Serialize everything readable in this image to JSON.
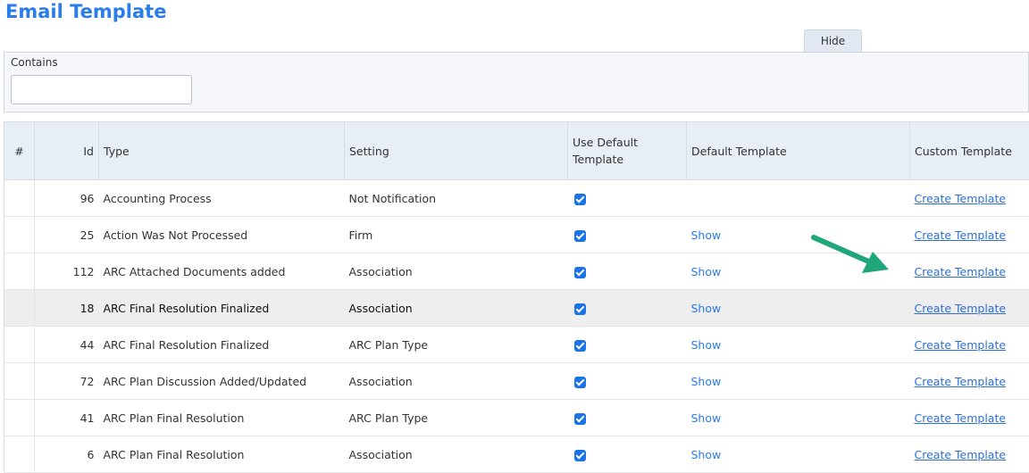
{
  "page": {
    "title": "Email Template"
  },
  "filter": {
    "hide_label": "Hide",
    "contains_label": "Contains",
    "contains_value": ""
  },
  "table": {
    "columns": {
      "num": "#",
      "id": "Id",
      "type": "Type",
      "setting": "Setting",
      "use_default": "Use Default Template",
      "default_template": "Default Template",
      "custom_template": "Custom Template"
    },
    "rows": [
      {
        "id": "96",
        "type": "Accounting Process",
        "setting": "Not Notification",
        "use_default": true,
        "default_template": "",
        "custom_template": "Create Template",
        "selected": false
      },
      {
        "id": "25",
        "type": "Action Was Not Processed",
        "setting": "Firm",
        "use_default": true,
        "default_template": "Show",
        "custom_template": "Create Template",
        "selected": false
      },
      {
        "id": "112",
        "type": "ARC Attached Documents added",
        "setting": "Association",
        "use_default": true,
        "default_template": "Show",
        "custom_template": "Create Template",
        "selected": false
      },
      {
        "id": "18",
        "type": "ARC Final Resolution Finalized",
        "setting": "Association",
        "use_default": true,
        "default_template": "Show",
        "custom_template": "Create Template",
        "selected": true
      },
      {
        "id": "44",
        "type": "ARC Final Resolution Finalized",
        "setting": "ARC Plan Type",
        "use_default": true,
        "default_template": "Show",
        "custom_template": "Create Template",
        "selected": false
      },
      {
        "id": "72",
        "type": "ARC Plan Discussion Added/Updated",
        "setting": "Association",
        "use_default": true,
        "default_template": "Show",
        "custom_template": "Create Template",
        "selected": false
      },
      {
        "id": "41",
        "type": "ARC Plan Final Resolution",
        "setting": "ARC Plan Type",
        "use_default": true,
        "default_template": "Show",
        "custom_template": "Create Template",
        "selected": false
      },
      {
        "id": "6",
        "type": "ARC Plan Final Resolution",
        "setting": "Association",
        "use_default": true,
        "default_template": "Show",
        "custom_template": "Create Template",
        "selected": false
      }
    ]
  },
  "annotation": {
    "arrow_color": "#1fa67a",
    "icon": "arrow-annotation-icon"
  }
}
